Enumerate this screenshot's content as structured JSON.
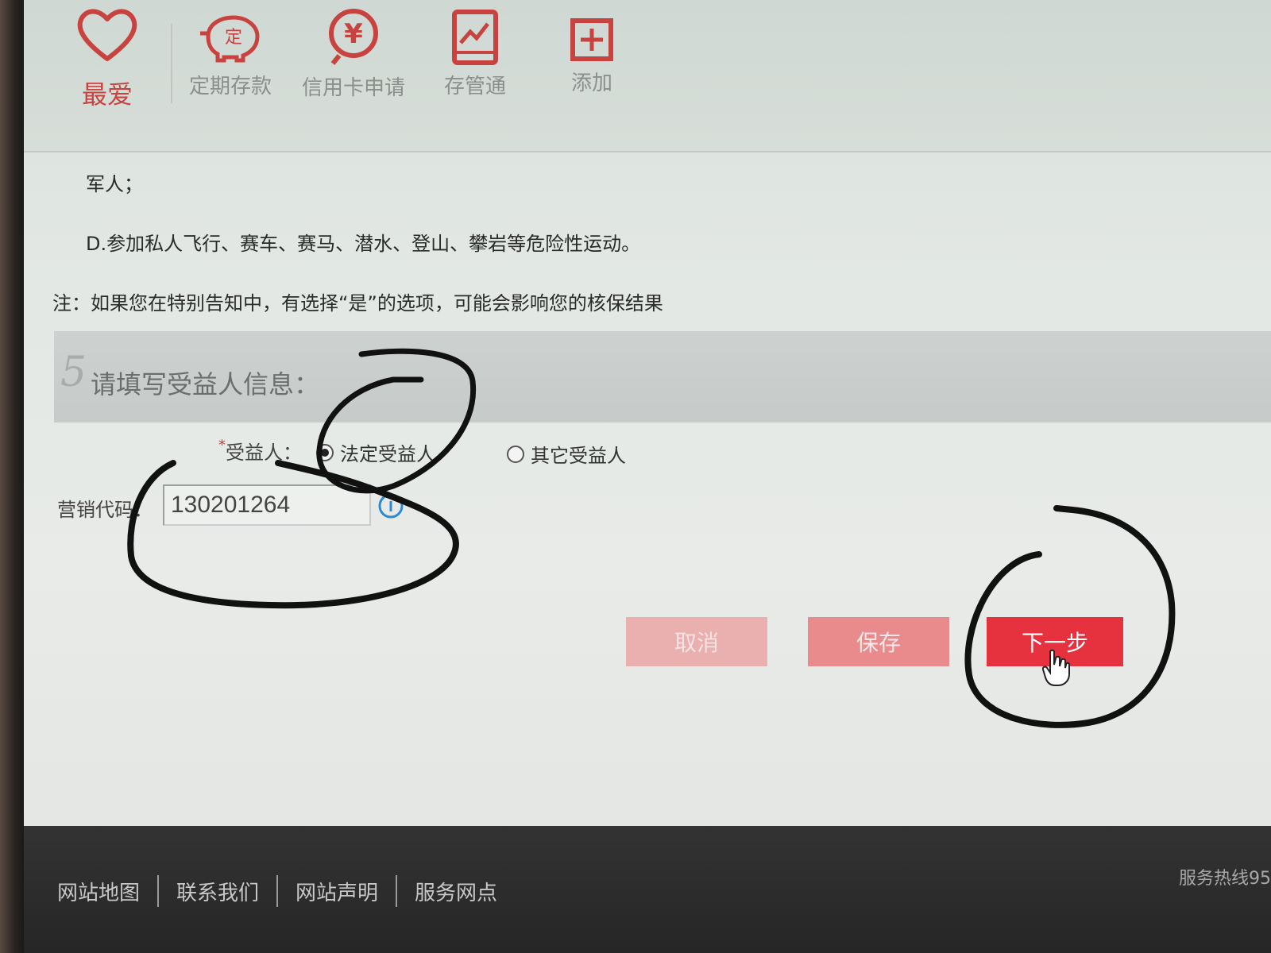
{
  "toolbar": {
    "items": [
      {
        "label": "最爱",
        "icon": "heart-icon"
      },
      {
        "label": "定期存款",
        "icon": "piggy-bank-icon"
      },
      {
        "label": "信用卡申请",
        "icon": "yuan-coin-icon"
      },
      {
        "label": "存管通",
        "icon": "tablet-chart-icon"
      },
      {
        "label": "添加",
        "icon": "add-box-icon"
      }
    ]
  },
  "notice": {
    "line1": "军人；",
    "line2": "D.参加私人飞行、赛车、赛马、潜水、登山、攀岩等危险性运动。",
    "note": "注：如果您在特别告知中，有选择“是”的选项，可能会影响您的核保结果"
  },
  "section": {
    "number": "5",
    "title": "请填写受益人信息："
  },
  "beneficiary": {
    "required_mark": "*",
    "label": "受益人：",
    "options": [
      "法定受益人",
      "其它受益人"
    ],
    "selected": "法定受益人"
  },
  "marketing_code": {
    "label": "营销代码：",
    "value": "130201264"
  },
  "buttons": {
    "cancel": "取消",
    "save": "保存",
    "next": "下一步"
  },
  "footer": {
    "links": [
      "网站地图",
      "联系我们",
      "网站声明",
      "服务网点"
    ],
    "hotline": "服务热线95"
  },
  "colors": {
    "brand_red": "#e5323e",
    "icon_red": "#c8433f",
    "footer_bg": "#2b2b2b"
  }
}
